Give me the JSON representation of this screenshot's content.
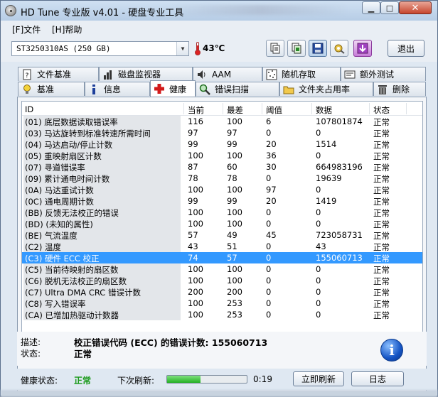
{
  "window": {
    "title": "HD Tune 专业版 v4.01 - 硬盘专业工具",
    "controls": {
      "minimize": "▁",
      "maximize": "□",
      "close": "✕"
    }
  },
  "menu": {
    "file": "[F]文件",
    "help": "[H]帮助"
  },
  "toolbar": {
    "drive": "ST3250310AS (250 GB)",
    "temperature": "43℃",
    "exit_label": "退出",
    "buttons": [
      "copy-text-icon",
      "copy-screenshot-icon",
      "save-icon",
      "options-icon",
      "download-icon"
    ]
  },
  "tabs": {
    "row1": [
      "文件基准",
      "磁盘监视器",
      "AAM",
      "随机存取",
      "额外测试"
    ],
    "row2": [
      "基准",
      "信息",
      "健康",
      "错误扫描",
      "文件夹占用率",
      "删除"
    ],
    "selected": "健康"
  },
  "columns": [
    "ID",
    "当前",
    "最差",
    "阈值",
    "数据",
    "状态"
  ],
  "rows": [
    {
      "id": "(01) 底层数据读取错误率",
      "cur": "116",
      "worst": "100",
      "thr": "6",
      "data": "107801874",
      "status": "正常"
    },
    {
      "id": "(03) 马达旋转到标准转速所需时间",
      "cur": "97",
      "worst": "97",
      "thr": "0",
      "data": "0",
      "status": "正常"
    },
    {
      "id": "(04) 马达启动/停止计数",
      "cur": "99",
      "worst": "99",
      "thr": "20",
      "data": "1514",
      "status": "正常"
    },
    {
      "id": "(05) 重映射扇区计数",
      "cur": "100",
      "worst": "100",
      "thr": "36",
      "data": "0",
      "status": "正常"
    },
    {
      "id": "(07) 寻道错误率",
      "cur": "87",
      "worst": "60",
      "thr": "30",
      "data": "664983196",
      "status": "正常"
    },
    {
      "id": "(09) 累计通电时间计数",
      "cur": "78",
      "worst": "78",
      "thr": "0",
      "data": "19639",
      "status": "正常"
    },
    {
      "id": "(0A) 马达重试计数",
      "cur": "100",
      "worst": "100",
      "thr": "97",
      "data": "0",
      "status": "正常"
    },
    {
      "id": "(0C) 通电周期计数",
      "cur": "99",
      "worst": "99",
      "thr": "20",
      "data": "1419",
      "status": "正常"
    },
    {
      "id": "(BB) 反馈无法校正的错误",
      "cur": "100",
      "worst": "100",
      "thr": "0",
      "data": "0",
      "status": "正常"
    },
    {
      "id": "(BD) (未知的属性)",
      "cur": "100",
      "worst": "100",
      "thr": "0",
      "data": "0",
      "status": "正常"
    },
    {
      "id": "(BE) 气流温度",
      "cur": "57",
      "worst": "49",
      "thr": "45",
      "data": "723058731",
      "status": "正常"
    },
    {
      "id": "(C2) 温度",
      "cur": "43",
      "worst": "51",
      "thr": "0",
      "data": "43",
      "status": "正常"
    },
    {
      "id": "(C3) 硬件 ECC 校正",
      "cur": "74",
      "worst": "57",
      "thr": "0",
      "data": "155060713",
      "status": "正常"
    },
    {
      "id": "(C5) 当前待映射的扇区数",
      "cur": "100",
      "worst": "100",
      "thr": "0",
      "data": "0",
      "status": "正常"
    },
    {
      "id": "(C6) 脱机无法校正的扇区数",
      "cur": "100",
      "worst": "100",
      "thr": "0",
      "data": "0",
      "status": "正常"
    },
    {
      "id": "(C7) Ultra DMA CRC 错误计数",
      "cur": "200",
      "worst": "200",
      "thr": "0",
      "data": "0",
      "status": "正常"
    },
    {
      "id": "(C8) 写入错误率",
      "cur": "100",
      "worst": "253",
      "thr": "0",
      "data": "0",
      "status": "正常"
    },
    {
      "id": "(CA) 已增加热驱动计数器",
      "cur": "100",
      "worst": "253",
      "thr": "0",
      "data": "0",
      "status": "正常"
    }
  ],
  "selected_row": 12,
  "description": {
    "desc_label": "描述:",
    "desc_value": "校正错误代码 (ECC) 的错误计数: 155060713",
    "status_label": "状态:",
    "status_value": "正常"
  },
  "bottom": {
    "health_label": "健康状态:",
    "health_value": "正常",
    "refresh_label": "下次刷新:",
    "progress": 0.42,
    "time": "0:19",
    "refresh_button": "立即刷新",
    "log_button": "日志"
  },
  "colors": {
    "selected_row": "#3399ff",
    "health_ok": "#1a9a1a",
    "progress": "#22b022"
  }
}
